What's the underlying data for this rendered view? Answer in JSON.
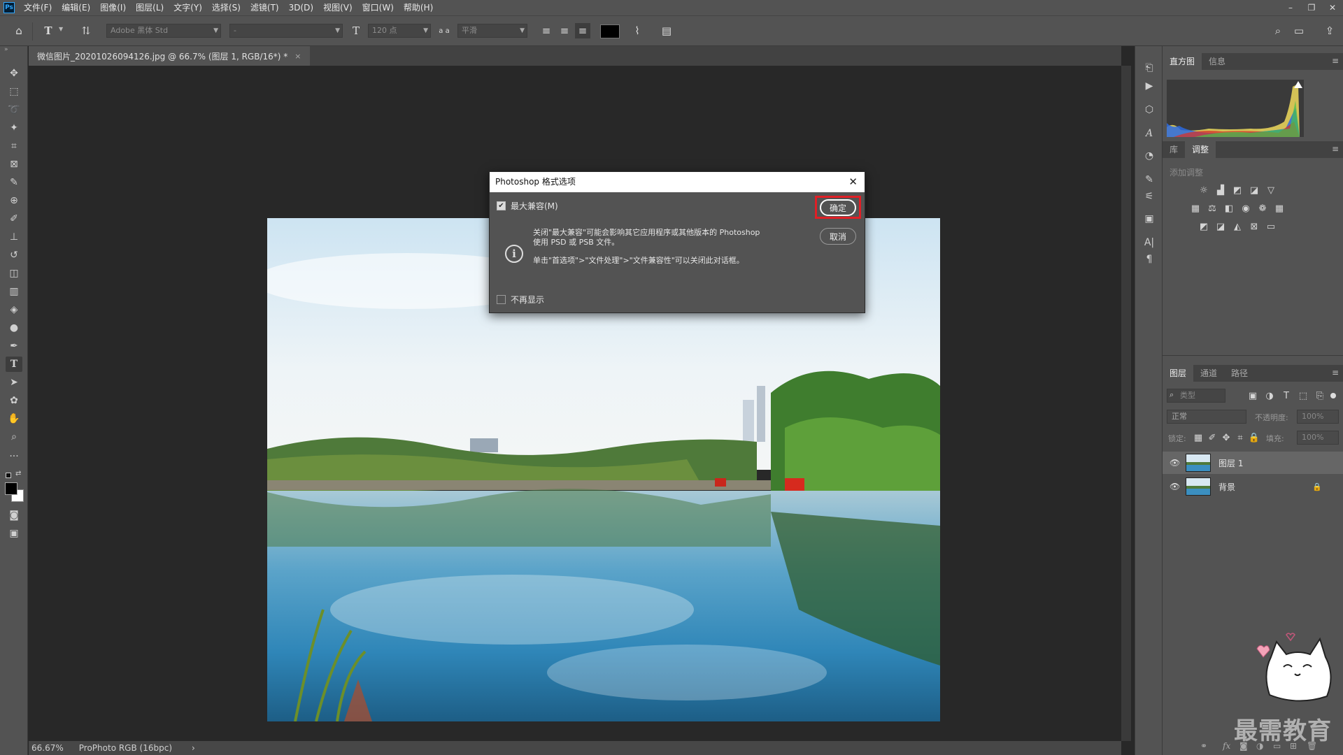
{
  "app": {
    "logo": "Ps"
  },
  "menu": [
    "文件(F)",
    "编辑(E)",
    "图像(I)",
    "图层(L)",
    "文字(Y)",
    "选择(S)",
    "滤镜(T)",
    "3D(D)",
    "视图(V)",
    "窗口(W)",
    "帮助(H)"
  ],
  "window_controls": {
    "minimize": "–",
    "restore": "❐",
    "close": "✕"
  },
  "options_bar": {
    "font_family": "Adobe 黑体 Std",
    "font_style": "-",
    "font_size": "120 点",
    "aa_label": "a a",
    "anti_alias": "平滑",
    "text_color": "#000000"
  },
  "document": {
    "tab_title": "微信图片_20201026094126.jpg @ 66.7% (图层 1, RGB/16*) *",
    "close": "×"
  },
  "status": {
    "zoom": "66.67%",
    "profile": "ProPhoto RGB (16bpc)",
    "arrow": "›"
  },
  "panels": {
    "histogram_tabs": [
      "直方图",
      "信息"
    ],
    "adjust_tabs": [
      "库",
      "调整"
    ],
    "adjust_title": "添加调整",
    "layers_tabs": [
      "图层",
      "通道",
      "路径"
    ],
    "filter_placeholder": "类型",
    "blend_mode": "正常",
    "opacity_label": "不透明度:",
    "opacity_value": "100%",
    "lock_label": "锁定:",
    "fill_label": "填充:",
    "fill_value": "100%",
    "layers": [
      {
        "name": "图层 1",
        "selected": true
      },
      {
        "name": "背景",
        "selected": false,
        "locked": true
      }
    ]
  },
  "dialog": {
    "title": "Photoshop 格式选项",
    "max_compat_label": "最大兼容(M)",
    "max_compat_checked": true,
    "message_line1": "关闭\"最大兼容\"可能会影响其它应用程序或其他版本的 Photoshop",
    "message_line2": "使用 PSD 或 PSB 文件。",
    "message_line3": "单击\"首选项\">\"文件处理\">\"文件兼容性\"可以关闭此对话框。",
    "dont_show_label": "不再显示",
    "ok_label": "确定",
    "cancel_label": "取消",
    "highlight_color": "#e11f26"
  },
  "watermark": "最需教育"
}
